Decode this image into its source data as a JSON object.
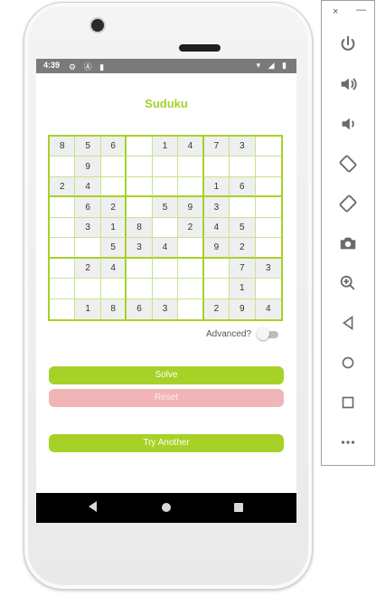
{
  "status": {
    "time": "4:39",
    "left_icons": "⚙ Ⓐ ▮",
    "right_icons": "▾ ◢ ▮"
  },
  "app": {
    "title": "Suduku"
  },
  "grid": {
    "rows": [
      [
        "8",
        "5",
        "6",
        "",
        "1",
        "4",
        "7",
        "3",
        ""
      ],
      [
        "",
        "9",
        "",
        "",
        "",
        "",
        "",
        "",
        ""
      ],
      [
        "2",
        "4",
        "",
        "",
        "",
        "",
        "1",
        "6",
        ""
      ],
      [
        "",
        "6",
        "2",
        "",
        "5",
        "9",
        "3",
        "",
        ""
      ],
      [
        "",
        "3",
        "1",
        "8",
        "",
        "2",
        "4",
        "5",
        ""
      ],
      [
        "",
        "",
        "5",
        "3",
        "4",
        "",
        "9",
        "2",
        ""
      ],
      [
        "",
        "2",
        "4",
        "",
        "",
        "",
        "",
        "7",
        "3"
      ],
      [
        "",
        "",
        "",
        "",
        "",
        "",
        "",
        "1",
        ""
      ],
      [
        "",
        "1",
        "8",
        "6",
        "3",
        "",
        "2",
        "9",
        "4"
      ]
    ],
    "shaded": [
      [
        1,
        1,
        1,
        0,
        1,
        1,
        1,
        1,
        0
      ],
      [
        0,
        1,
        0,
        0,
        0,
        0,
        0,
        0,
        0
      ],
      [
        1,
        1,
        0,
        0,
        0,
        0,
        1,
        1,
        0
      ],
      [
        0,
        1,
        1,
        0,
        1,
        1,
        1,
        0,
        0
      ],
      [
        0,
        1,
        1,
        1,
        0,
        1,
        1,
        1,
        0
      ],
      [
        0,
        0,
        1,
        1,
        1,
        0,
        1,
        1,
        0
      ],
      [
        0,
        1,
        1,
        0,
        0,
        0,
        0,
        1,
        1
      ],
      [
        0,
        0,
        0,
        0,
        0,
        0,
        0,
        1,
        0
      ],
      [
        0,
        1,
        1,
        1,
        1,
        0,
        1,
        1,
        1
      ]
    ]
  },
  "advanced": {
    "label": "Advanced?",
    "enabled": false
  },
  "buttons": {
    "solve": "Solve",
    "reset": "Reset",
    "try_another": "Try Another"
  },
  "colors": {
    "accent": "#a6d127",
    "reset": "#f1b5b8",
    "grid_line": "#c5e58a",
    "given_cell": "#efefef"
  },
  "toolbar": {
    "close": "×",
    "minimize": "—",
    "items": [
      "power-icon",
      "volume-up-icon",
      "volume-down-icon",
      "rotate-left-icon",
      "rotate-right-icon",
      "camera-icon",
      "zoom-icon",
      "back-icon",
      "home-icon",
      "overview-icon",
      "more-icon"
    ]
  }
}
